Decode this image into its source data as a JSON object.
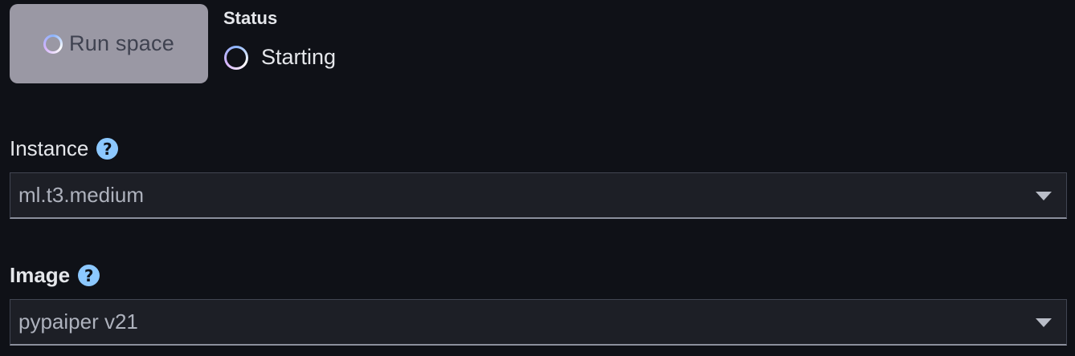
{
  "run_button": {
    "label": "Run space",
    "icon": "loading-spinner-icon"
  },
  "status": {
    "heading": "Status",
    "value": "Starting",
    "icon": "loading-spinner-icon"
  },
  "instance": {
    "label": "Instance",
    "help_icon": "help-icon",
    "help_glyph": "?",
    "selected": "ml.t3.medium"
  },
  "image": {
    "label": "Image",
    "help_icon": "help-icon",
    "help_glyph": "?",
    "selected": "pypaiper v21"
  },
  "colors": {
    "background": "#0f1117",
    "button_disabled": "#9a98a4",
    "help_icon": "#8cc8ff",
    "select_background": "#1d1f26"
  }
}
